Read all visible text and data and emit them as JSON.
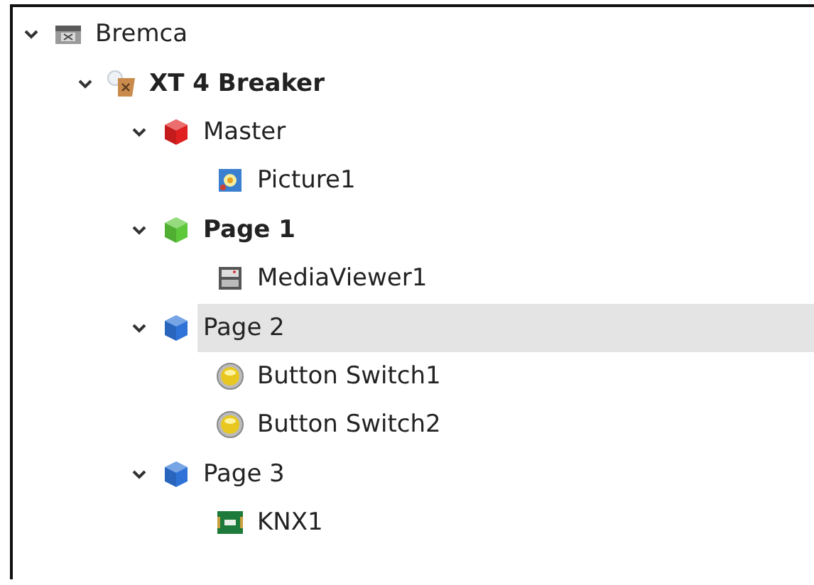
{
  "tree": [
    {
      "label": "Bremca",
      "kind": "project",
      "bold": false,
      "selected": false,
      "expanded": true,
      "children": [
        {
          "label": "XT 4 Breaker",
          "kind": "device",
          "bold": true,
          "selected": false,
          "expanded": true,
          "children": [
            {
              "label": "Master",
              "kind": "page",
              "color": "#e02020",
              "bold": false,
              "selected": false,
              "expanded": true,
              "children": [
                {
                  "label": "Picture1",
                  "kind": "picture",
                  "bold": false,
                  "selected": false
                }
              ]
            },
            {
              "label": "Page 1",
              "kind": "page",
              "color": "#5cc83a",
              "bold": true,
              "selected": false,
              "expanded": true,
              "children": [
                {
                  "label": "MediaViewer1",
                  "kind": "media-viewer",
                  "bold": false,
                  "selected": false
                }
              ]
            },
            {
              "label": "Page 2",
              "kind": "page",
              "color": "#2f73d8",
              "bold": false,
              "selected": true,
              "expanded": true,
              "children": [
                {
                  "label": "Button Switch1",
                  "kind": "button-switch",
                  "bold": false,
                  "selected": false
                },
                {
                  "label": "Button Switch2",
                  "kind": "button-switch",
                  "bold": false,
                  "selected": false
                }
              ]
            },
            {
              "label": "Page 3",
              "kind": "page",
              "color": "#2f73d8",
              "bold": false,
              "selected": false,
              "expanded": true,
              "children": [
                {
                  "label": "KNX1",
                  "kind": "knx",
                  "bold": false,
                  "selected": false
                }
              ]
            }
          ]
        }
      ]
    }
  ]
}
